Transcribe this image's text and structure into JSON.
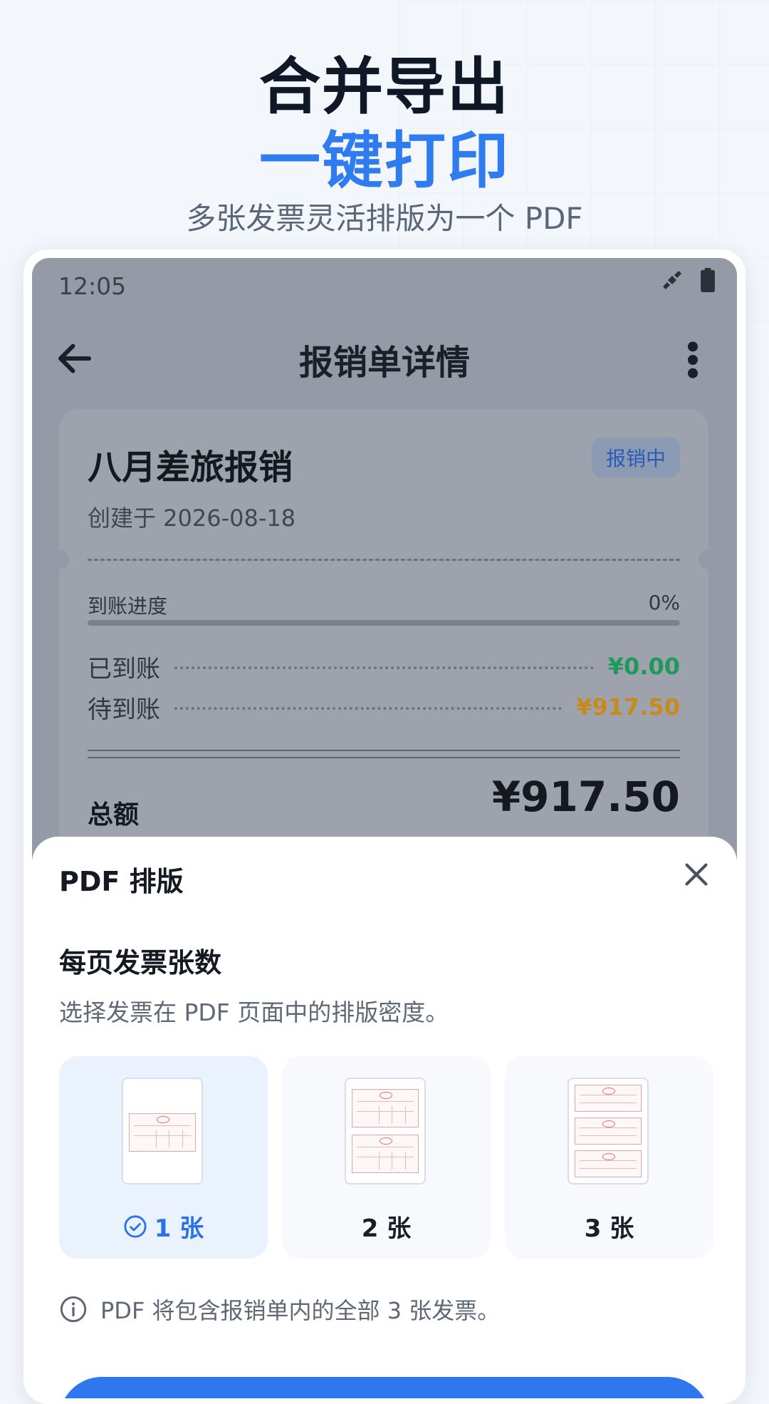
{
  "hero": {
    "line1": "合并导出",
    "line2": "一键打印",
    "subtitle": "多张发票灵活排版为一个 PDF"
  },
  "status_bar": {
    "time": "12:05",
    "icons": [
      "satellite-icon",
      "battery-icon"
    ]
  },
  "app_bar": {
    "title": "报销单详情",
    "back_icon": "arrow-left-icon",
    "menu_icon": "more-vertical-icon"
  },
  "report_card": {
    "title": "八月差旅报销",
    "status_badge": "报销中",
    "created": "创建于 2026-08-18",
    "progress_label": "到账进度",
    "progress_value": "0%",
    "progress_fraction": 0,
    "received_label": "已到账",
    "received_value": "¥0.00",
    "pending_label": "待到账",
    "pending_value": "¥917.50",
    "total_label": "总额",
    "total_value": "¥917.50"
  },
  "sheet": {
    "title": "PDF 排版",
    "section_title": "每页发票张数",
    "section_desc": "选择发票在 PDF 页面中的排版密度。",
    "options": [
      {
        "label": "1 张",
        "selected": true
      },
      {
        "label": "2 张",
        "selected": false
      },
      {
        "label": "3 张",
        "selected": false
      }
    ],
    "info_text": "PDF 将包含报销单内的全部 3 张发票。"
  },
  "colors": {
    "accent": "#2f7bf0",
    "received": "#1f9a5a",
    "pending": "#c98a1c"
  }
}
